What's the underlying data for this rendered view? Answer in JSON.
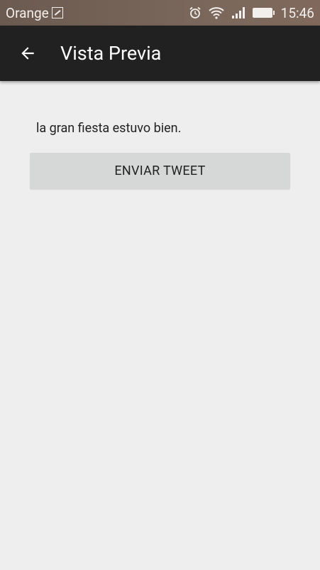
{
  "status_bar": {
    "carrier": "Orange",
    "time": "15:46"
  },
  "app_bar": {
    "title": "Vista Previa"
  },
  "content": {
    "message": "la gran fiesta estuvo bien.",
    "send_button": "ENVIAR TWEET"
  }
}
